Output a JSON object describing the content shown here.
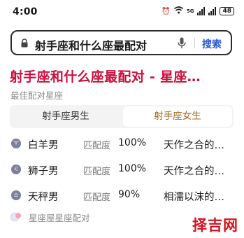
{
  "status_bar": {
    "time": "4:00",
    "network": "5G",
    "battery": "48"
  },
  "search": {
    "query": "射手座和什么座最配对",
    "button_label": "搜索"
  },
  "result": {
    "title": "射手座和什么座最配对 - 星座…",
    "subtitle": "最佳配对星座",
    "tabs": [
      {
        "label": "射手座男生",
        "active": false
      },
      {
        "label": "射手座女生",
        "active": true
      }
    ],
    "matches": [
      {
        "icon": "aries-icon",
        "symbol": "♈",
        "name": "白羊男",
        "label": "匹配度",
        "value": "100%",
        "desc": "天作之合的…"
      },
      {
        "icon": "leo-icon",
        "symbol": "♌",
        "name": "狮子男",
        "label": "匹配度",
        "value": "100%",
        "desc": "天作之合的…"
      },
      {
        "icon": "libra-icon",
        "symbol": "♎",
        "name": "天秤男",
        "label": "匹配度",
        "value": "90%",
        "desc": "相濡以沫的…"
      }
    ],
    "source": "星座屋星座配对"
  },
  "watermark": "择吉网",
  "colors": {
    "title": "#c8103e",
    "search_button": "#2456d6",
    "active_tab": "#a0661a",
    "watermark": "#d3131f"
  }
}
